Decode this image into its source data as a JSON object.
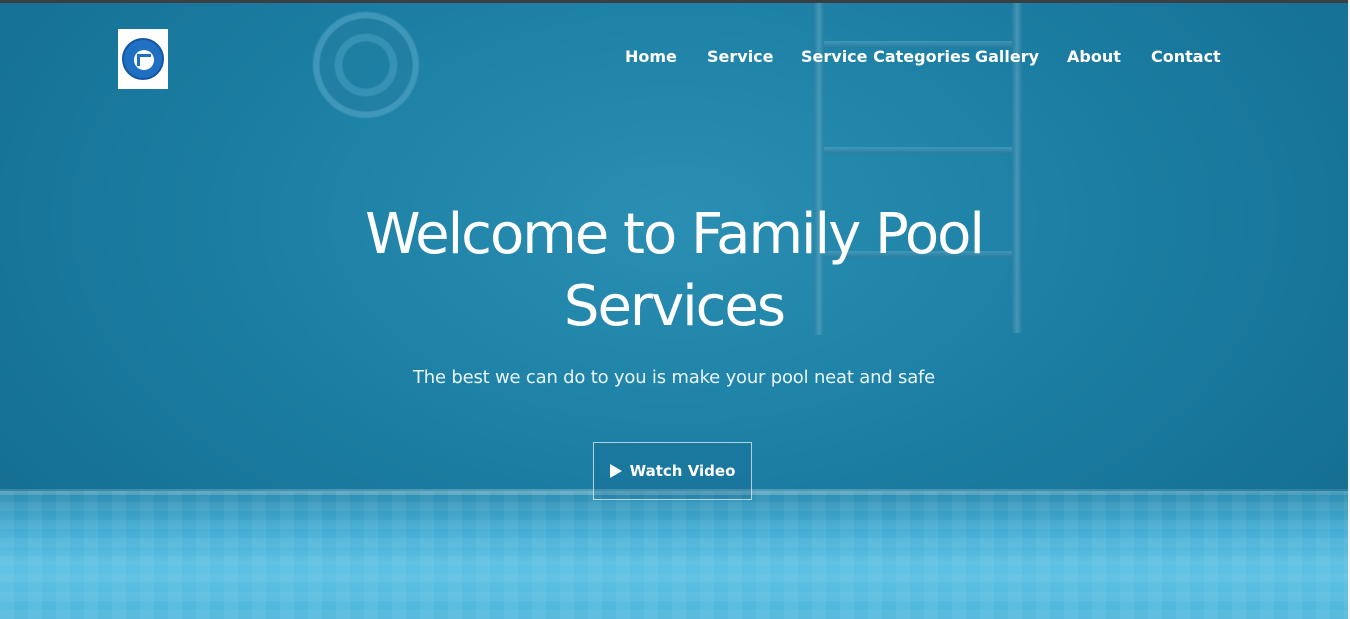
{
  "brand": {
    "logo_alt": "Family Pool Services logo"
  },
  "nav": {
    "items": [
      {
        "label": "Home"
      },
      {
        "label": "Service"
      },
      {
        "label": "Service Categories"
      },
      {
        "label": "Gallery"
      },
      {
        "label": "About"
      },
      {
        "label": "Contact"
      }
    ]
  },
  "hero": {
    "title_line1": "Welcome to Family Pool",
    "title_line2": "Services",
    "subtitle": "The best we can do to you is make your pool neat and safe",
    "cta_label": "Watch Video",
    "cta_icon": "play-icon"
  },
  "colors": {
    "water": "#1c7ea3",
    "floor": "#4fb7dc",
    "text": "#ffffff"
  }
}
